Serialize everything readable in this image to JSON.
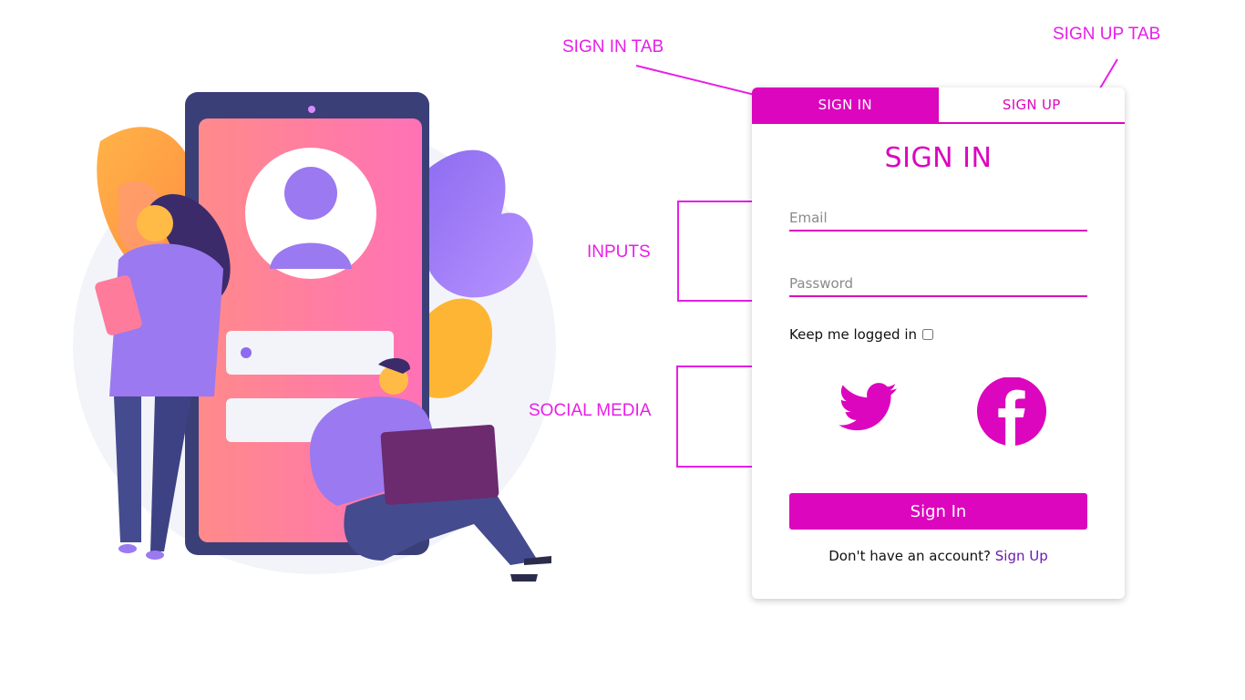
{
  "annotations": {
    "sign_in_tab": "SIGN IN TAB",
    "sign_up_tab": "SIGN UP TAB",
    "inputs": "INPUTS",
    "social_media": "SOCIAL MEDIA"
  },
  "card": {
    "tabs": [
      {
        "label": "SIGN IN",
        "active": true
      },
      {
        "label": "SIGN UP",
        "active": false
      }
    ],
    "title": "SIGN IN",
    "email": {
      "placeholder": "Email",
      "value": ""
    },
    "password": {
      "placeholder": "Password",
      "value": ""
    },
    "remember_label": "Keep me logged in",
    "remember_checked": false,
    "social": [
      "twitter-icon",
      "facebook-icon"
    ],
    "submit_label": "Sign In",
    "signup_prompt": "Don't have an account?",
    "signup_link": "Sign Up"
  },
  "colors": {
    "accent": "#dc06be",
    "annotation": "#e81ee8",
    "link": "#6b1bb0",
    "illustration_purple": "#9b79f0",
    "illustration_pink": "#ff7eb0",
    "illustration_orange": "#ffa84a"
  }
}
